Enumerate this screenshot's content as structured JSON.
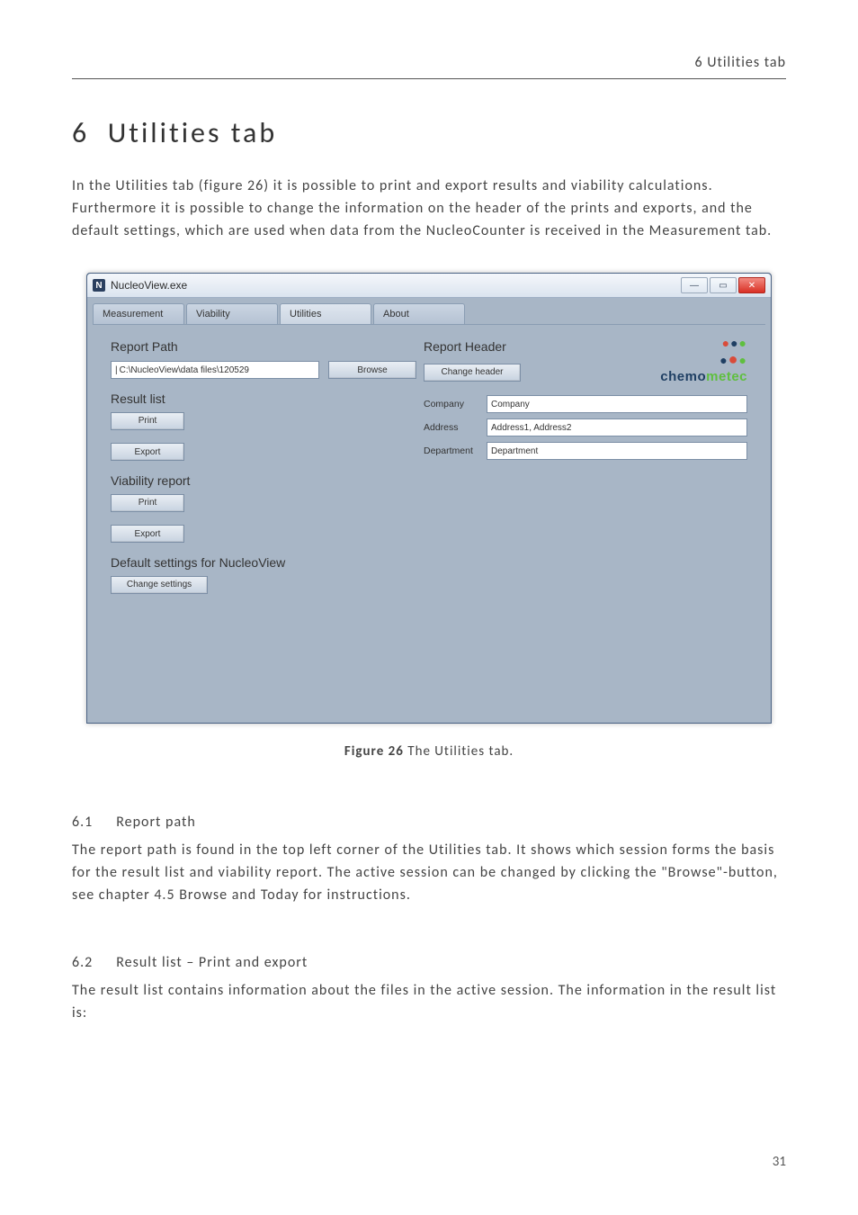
{
  "running_header": "6 Utilities tab",
  "section_title_num": "6",
  "section_title_text": "Utilities tab",
  "intro_text": "In the Utilities tab (figure 26) it is possible to print and export results and viability calculations. Furthermore it is possible to change the information on the header of the prints and exports, and the default settings, which are used when data from the NucleoCounter is received in the Measurement tab.",
  "figure_caption_label": "Figure 26",
  "figure_caption_text": " The Utilities tab.",
  "sub_6_1_num": "6.1",
  "sub_6_1_title": "Report path",
  "sub_6_1_body": "The report path is found in the top left corner of the Utilities tab. It shows which session forms the basis for the result list and viability report. The active session can be changed by clicking the \"Browse\"-button, see chapter 4.5 Browse and Today for instructions.",
  "sub_6_2_num": "6.2",
  "sub_6_2_title": "Result list – Print and export",
  "sub_6_2_body": "The result list contains information about the files in the active session. The information in the result list is:",
  "page_number": "31",
  "window": {
    "title": "NucleoView.exe",
    "tabs": {
      "measurement": "Measurement",
      "viability": "Viability",
      "utilities": "Utilities",
      "about": "About"
    },
    "report_path_label": "Report Path",
    "report_path_value": "C:\\NucleoView\\data files\\120529",
    "browse_btn": "Browse",
    "result_list_label": "Result list",
    "print_btn": "Print",
    "export_btn": "Export",
    "viability_report_label": "Viability report",
    "default_settings_label": "Default settings for NucleoView",
    "change_settings_btn": "Change settings",
    "report_header_label": "Report Header",
    "change_header_btn": "Change header",
    "company_label": "Company",
    "company_value": "Company",
    "address_label": "Address",
    "address_value": "Address1, Address2",
    "department_label": "Department",
    "department_value": "Department",
    "brand_chemo": "chemo",
    "brand_metec": "metec"
  }
}
